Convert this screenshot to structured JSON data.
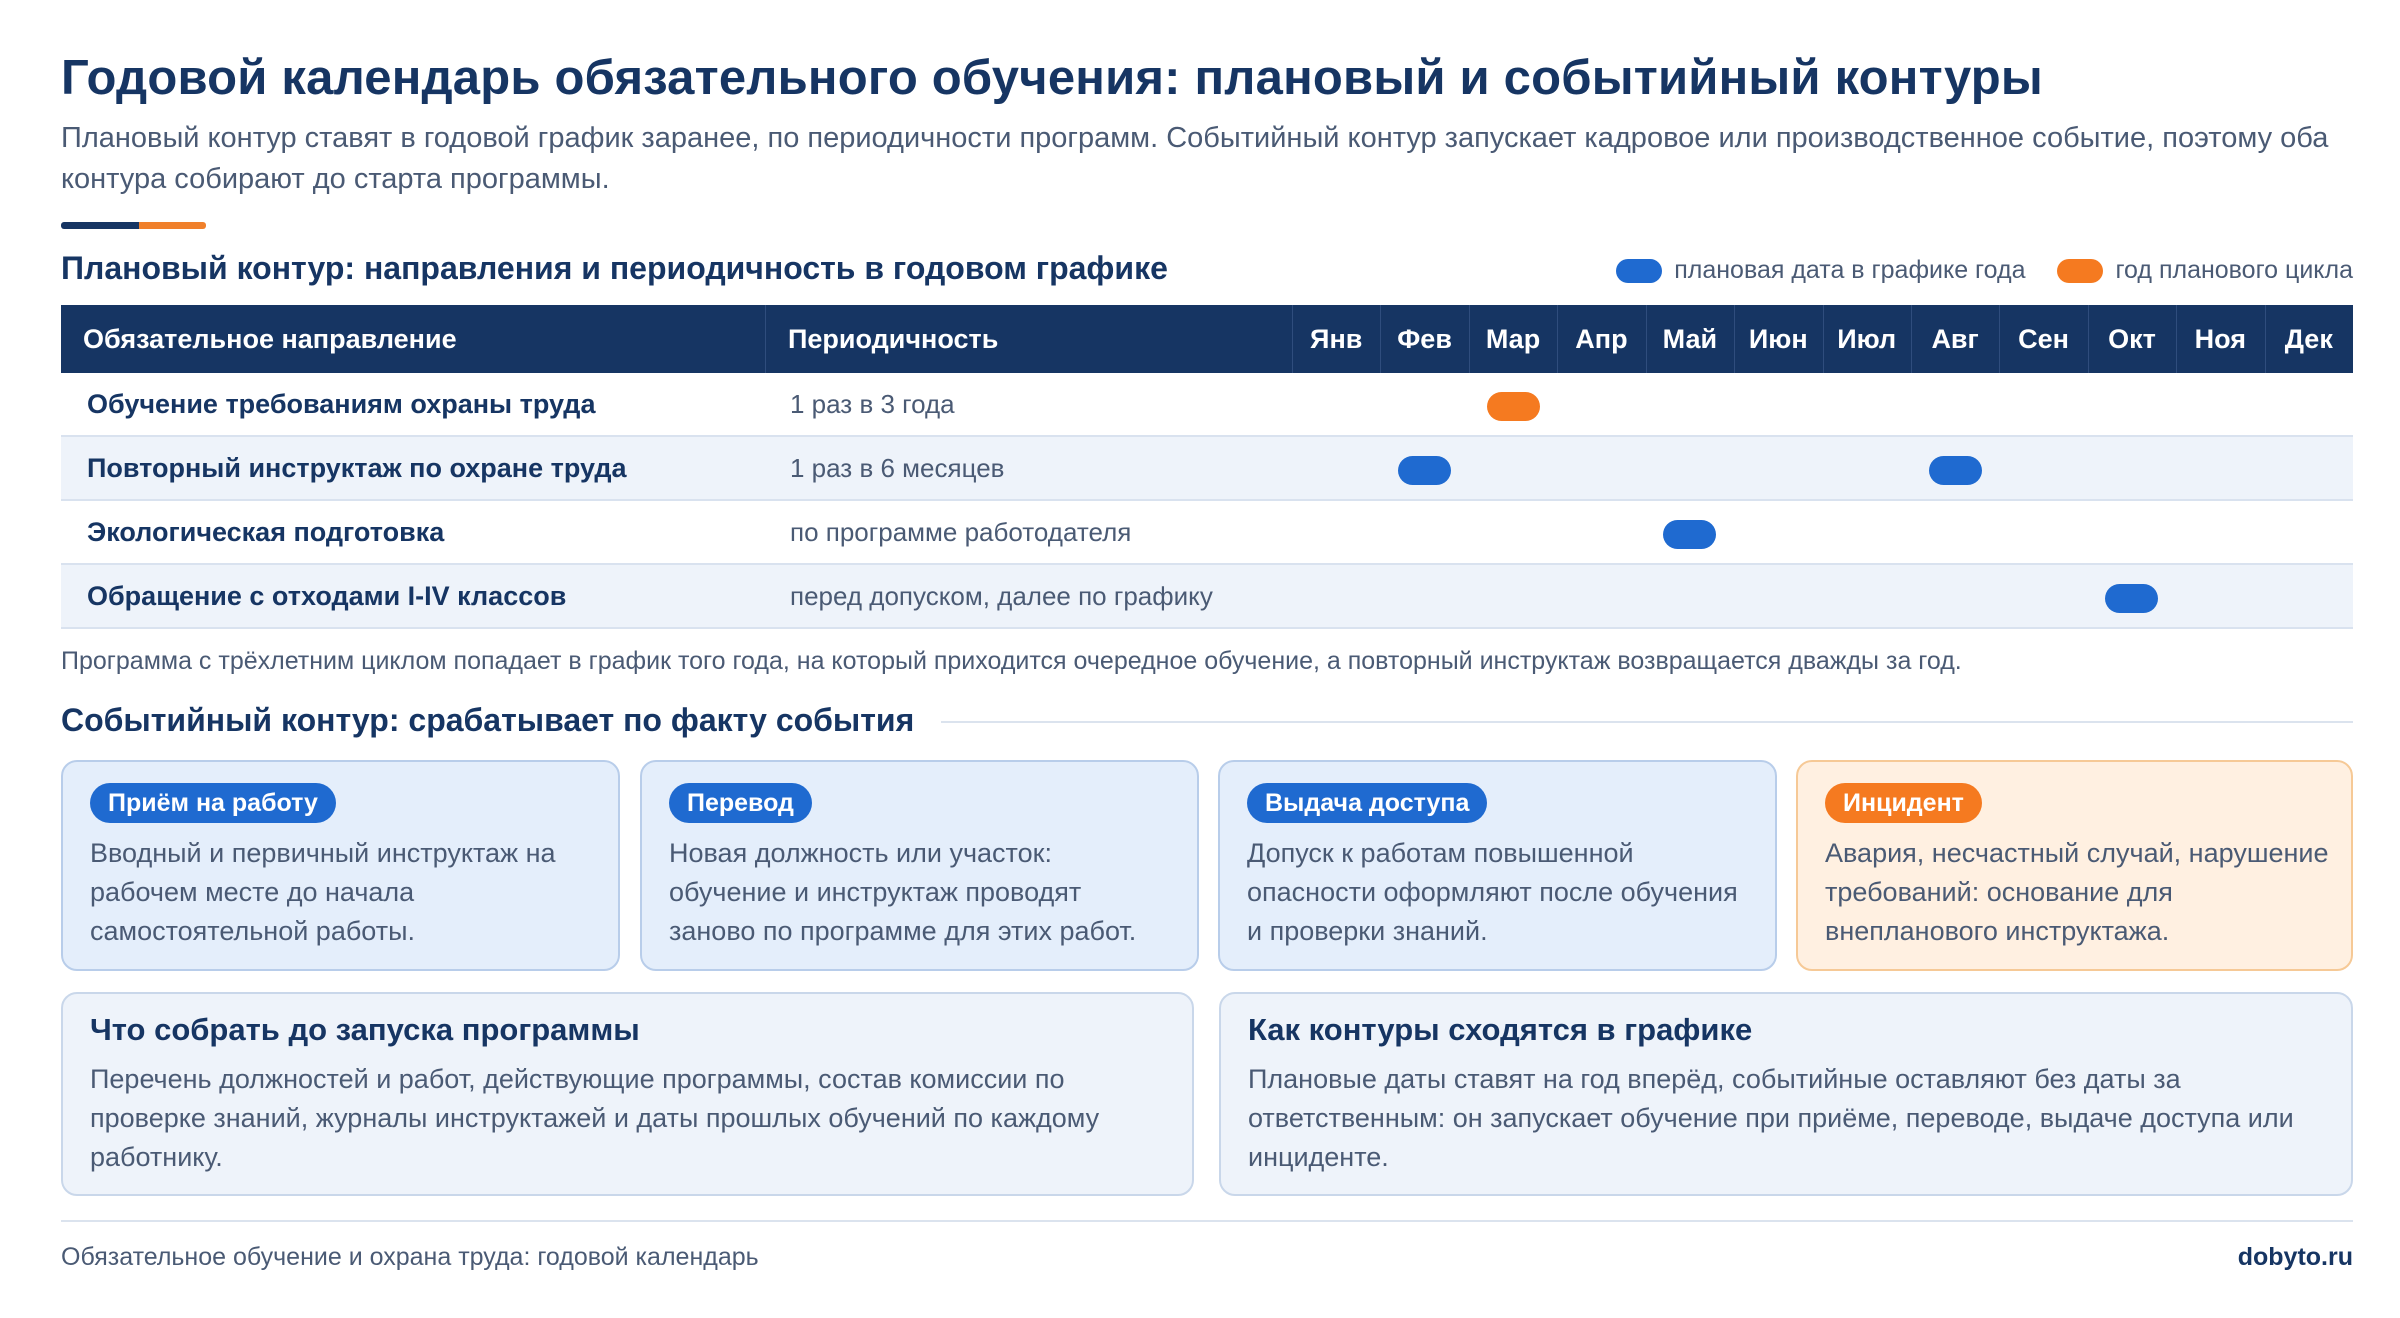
{
  "header": {
    "title": "Годовой календарь обязательного обучения: плановый и событийный контуры",
    "subtitle": "Плановый контур ставят в годовой график заранее, по периодичности программ. Событийный контур запускает кадровое или производственное событие, поэтому оба контура собирают до старта программы."
  },
  "colors": {
    "navy": "#163563",
    "plan_blue": "#1f6ad0",
    "cycle_orange": "#f57a20"
  },
  "planned": {
    "heading": "Плановый контур: направления и периодичность в годовом графике",
    "legend": {
      "plan_label": "плановая дата в графике года",
      "cycle_label": "год планового цикла"
    },
    "columns": {
      "direction": "Обязательное направление",
      "periodicity": "Периодичность",
      "months": [
        "Янв",
        "Фев",
        "Мар",
        "Апр",
        "Май",
        "Июн",
        "Июл",
        "Авг",
        "Сен",
        "Окт",
        "Ноя",
        "Дек"
      ]
    },
    "rows": [
      {
        "name": "Обучение требованиям охраны труда",
        "period": "1 раз в 3 года",
        "marks": [
          {
            "month": "Мар",
            "kind": "cycle"
          }
        ]
      },
      {
        "name": "Повторный инструктаж по охране труда",
        "period": "1 раз в 6 месяцев",
        "marks": [
          {
            "month": "Фев",
            "kind": "plan"
          },
          {
            "month": "Авг",
            "kind": "plan"
          }
        ]
      },
      {
        "name": "Экологическая подготовка",
        "period": "по программе работодателя",
        "marks": [
          {
            "month": "Май",
            "kind": "plan"
          }
        ]
      },
      {
        "name": "Обращение с отходами I-IV классов",
        "period": "перед допуском, далее по графику",
        "marks": [
          {
            "month": "Окт",
            "kind": "plan"
          }
        ]
      }
    ],
    "note": "Программа с трёхлетним циклом попадает в график того года, на который приходится очередное обучение, а повторный инструктаж возвращается дважды за год."
  },
  "event": {
    "heading": "Событийный контур: срабатывает по факту события",
    "cards": [
      {
        "badge": "Приём на работу",
        "text": "Вводный и первичный инструктаж на рабочем месте до начала самостоятельной работы."
      },
      {
        "badge": "Перевод",
        "text": "Новая должность или участок: обучение и инструктаж проводят заново по программе для этих работ."
      },
      {
        "badge": "Выдача доступа",
        "text": "Допуск к работам повышенной опасности оформляют после обучения и проверки знаний."
      },
      {
        "badge": "Инцидент",
        "text": "Авария, несчастный случай, нарушение требований: основание для внепланового инструктажа."
      }
    ]
  },
  "summary": {
    "collect": {
      "title": "Что собрать до запуска программы",
      "text": "Перечень должностей и работ, действующие программы, состав комиссии по проверке знаний, журналы инструктажей и даты прошлых обучений по каждому работнику."
    },
    "merge": {
      "title": "Как контуры сходятся в графике",
      "text": "Плановые даты ставят на год вперёд, событийные оставляют без даты за ответственным: он запускает обучение при приёме, переводе, выдаче доступа или инциденте."
    }
  },
  "footer": {
    "left": "Обязательное обучение и охрана труда: годовой календарь",
    "right": "dobyto.ru"
  }
}
